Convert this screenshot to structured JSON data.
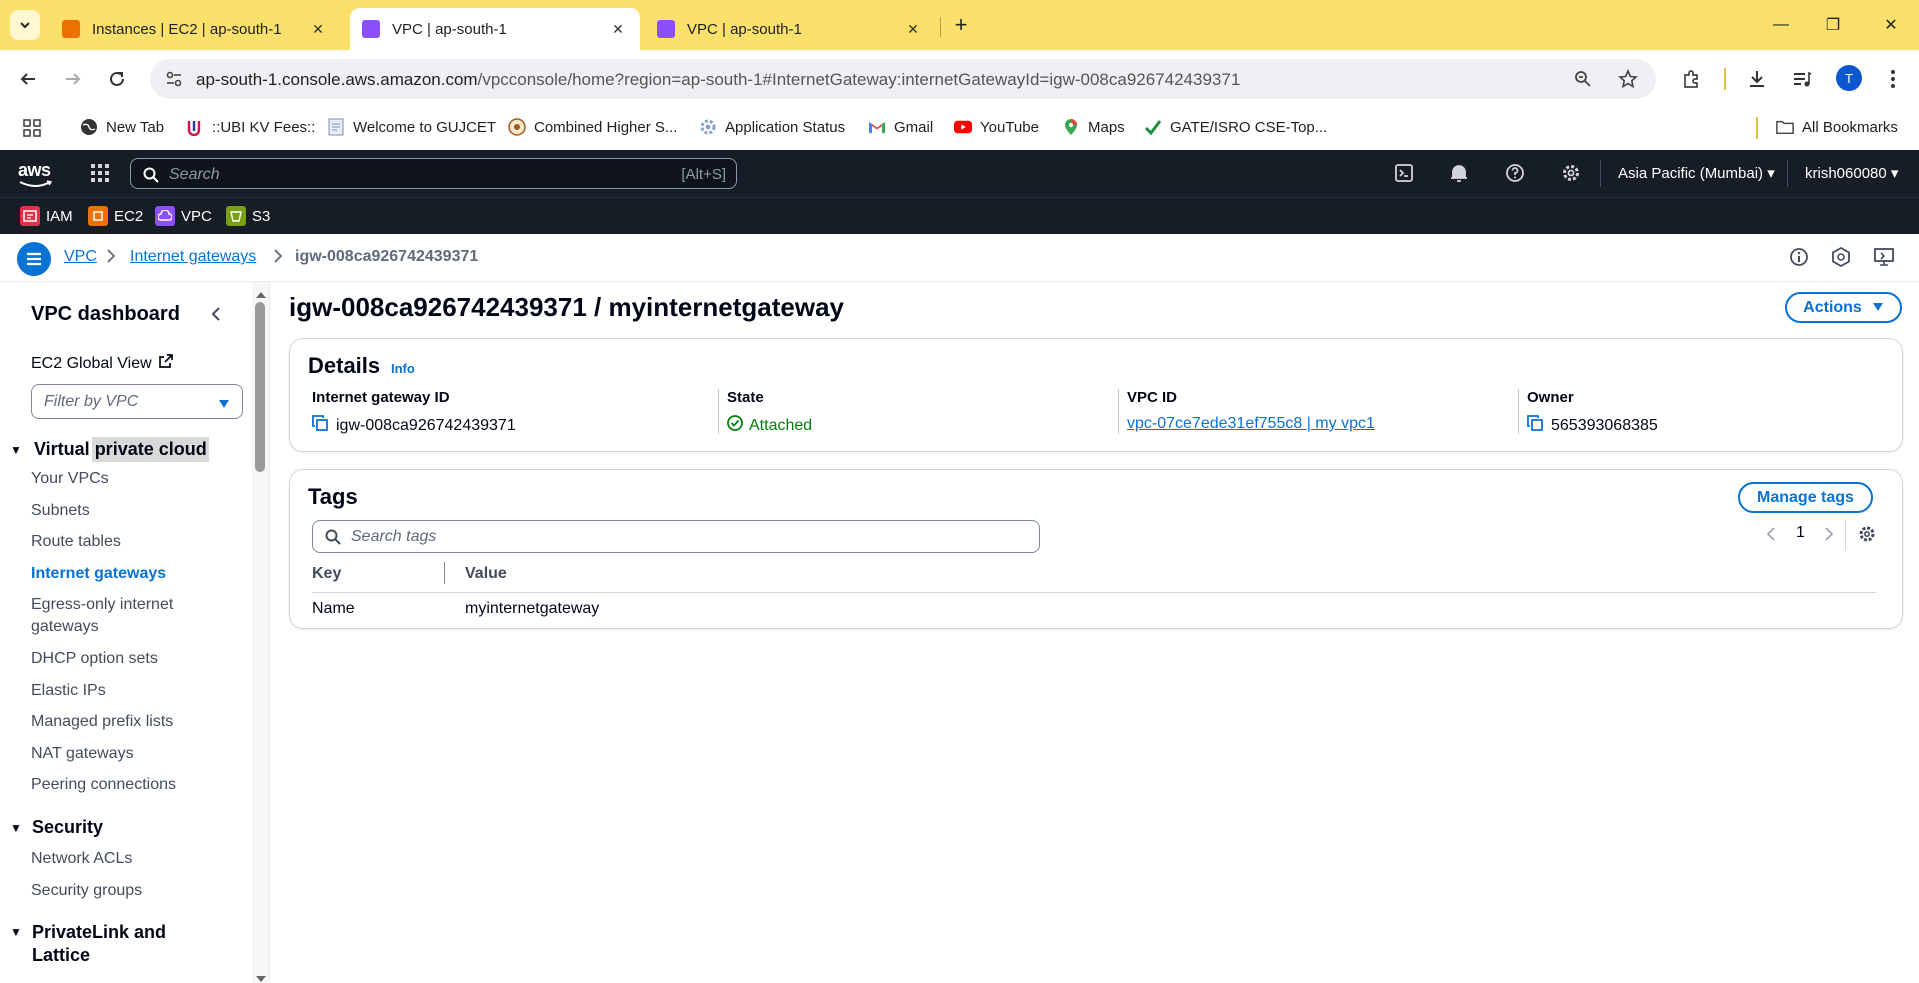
{
  "browser": {
    "tabs": [
      {
        "title": "Instances | EC2 | ap-south-1",
        "active": false,
        "favicon_color": "#ed7100"
      },
      {
        "title": "VPC | ap-south-1",
        "active": true,
        "favicon_color": "#8c4fff"
      },
      {
        "title": "VPC | ap-south-1",
        "active": false,
        "favicon_color": "#8c4fff"
      }
    ],
    "url_host": "ap-south-1.console.aws.amazon.com",
    "url_path": "/vpcconsole/home?region=ap-south-1#InternetGateway:internetGatewayId=igw-008ca926742439371",
    "avatar_letter": "T",
    "bookmarks": [
      {
        "label": "New Tab",
        "icon": "globe-icon"
      },
      {
        "label": "::UBI KV Fees::",
        "icon": "ubi-icon"
      },
      {
        "label": "Welcome to GUJCET",
        "icon": "doc-icon"
      },
      {
        "label": "Combined Higher S...",
        "icon": "emblem-icon"
      },
      {
        "label": "Application Status",
        "icon": "gear-icon"
      },
      {
        "label": "Gmail",
        "icon": "gmail-icon"
      },
      {
        "label": "YouTube",
        "icon": "youtube-icon"
      },
      {
        "label": "Maps",
        "icon": "maps-icon"
      },
      {
        "label": "GATE/ISRO CSE-Top...",
        "icon": "check-icon"
      }
    ],
    "all_bookmarks": "All Bookmarks"
  },
  "aws": {
    "logo": "aws",
    "search_placeholder": "Search",
    "search_shortcut": "[Alt+S]",
    "region": "Asia Pacific (Mumbai)",
    "user": "krish060080",
    "favorites": [
      {
        "label": "IAM",
        "color": "#dd344c"
      },
      {
        "label": "EC2",
        "color": "#ed7100"
      },
      {
        "label": "VPC",
        "color": "#8c4fff"
      },
      {
        "label": "S3",
        "color": "#7aa116"
      }
    ]
  },
  "breadcrumb": {
    "items": [
      "VPC",
      "Internet gateways"
    ],
    "current": "igw-008ca926742439371"
  },
  "sidebar": {
    "title": "VPC dashboard",
    "global_view": "EC2 Global View",
    "filter_placeholder": "Filter by VPC",
    "section_vpc": "Virtual private cloud",
    "vpc_items": [
      "Your VPCs",
      "Subnets",
      "Route tables",
      "Internet gateways",
      "Egress-only internet",
      "gateways",
      "DHCP option sets",
      "Elastic IPs",
      "Managed prefix lists",
      "NAT gateways",
      "Peering connections"
    ],
    "section_security": "Security",
    "security_items": [
      "Network ACLs",
      "Security groups"
    ],
    "section_privatelink": "PrivateLink and",
    "section_privatelink_2": "Lattice"
  },
  "page": {
    "title": "igw-008ca926742439371 / myinternetgateway",
    "actions_label": "Actions",
    "details": {
      "heading": "Details",
      "info": "Info",
      "igw_label": "Internet gateway ID",
      "igw_value": "igw-008ca926742439371",
      "state_label": "State",
      "state_value": "Attached",
      "vpc_label": "VPC ID",
      "vpc_value": "vpc-07ce7ede31ef755c8 | my vpc1",
      "owner_label": "Owner",
      "owner_value": "565393068385"
    },
    "tags": {
      "heading": "Tags",
      "manage_label": "Manage tags",
      "search_placeholder": "Search tags",
      "page_number": "1",
      "col_key": "Key",
      "col_value": "Value",
      "rows": [
        {
          "key": "Name",
          "value": "myinternetgateway"
        }
      ]
    }
  }
}
